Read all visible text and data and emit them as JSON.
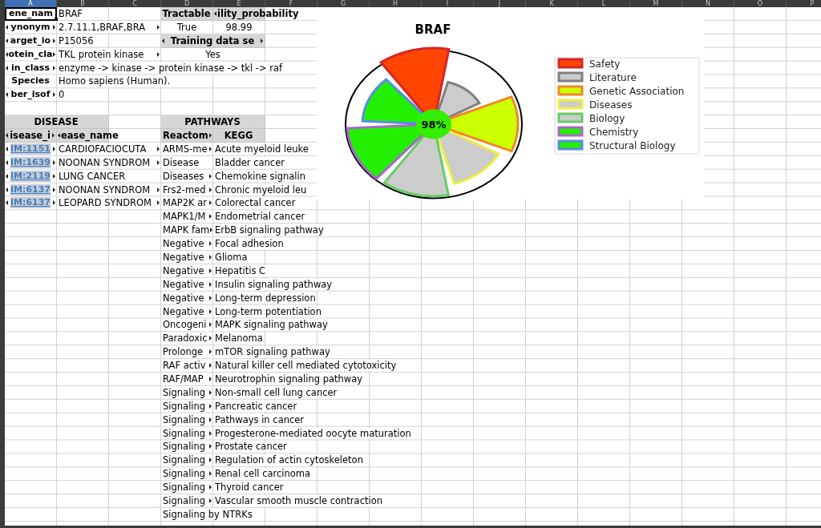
{
  "column_headers": [
    {
      "label": "A",
      "selected": true
    },
    {
      "label": "B",
      "selected": false
    },
    {
      "label": "C",
      "selected": false
    },
    {
      "label": "D",
      "selected": false
    },
    {
      "label": "E",
      "selected": false
    },
    {
      "label": "F",
      "selected": false
    },
    {
      "label": "G",
      "selected": false
    },
    {
      "label": "H",
      "selected": false
    },
    {
      "label": "I",
      "selected": false
    },
    {
      "label": "J",
      "selected": false
    },
    {
      "label": "K",
      "selected": false
    },
    {
      "label": "L",
      "selected": false
    },
    {
      "label": "M",
      "selected": false
    },
    {
      "label": "N",
      "selected": false
    },
    {
      "label": "O",
      "selected": false
    },
    {
      "label": "P",
      "selected": false
    }
  ],
  "sheet": {
    "rows": [
      {
        "cells": {
          "col_a": {
            "text": "ene_nam",
            "kind": "label",
            "centered": true,
            "selected": true
          },
          "col_b": {
            "text": "BRAF",
            "kind": "text",
            "selected": false
          },
          "col_d": {
            "text": "Tractable",
            "kind": "header",
            "centered": true,
            "selected": false
          },
          "col_e": {
            "text": "ility_probability",
            "kind": "header",
            "clipped_left": true,
            "selected": false
          }
        }
      },
      {
        "cells": {
          "col_a": {
            "text": "ynonym",
            "kind": "label",
            "centered": true,
            "clipped_left": true,
            "clipped_right": true,
            "selected": false
          },
          "col_b": {
            "text": "2.7.11.1,BRAF,BRA",
            "kind": "text",
            "clipped_right": true,
            "selected": false
          },
          "col_d": {
            "text": "True",
            "kind": "text",
            "centered": true,
            "selected": false
          },
          "col_e": {
            "text": "98.99",
            "kind": "text",
            "centered": true,
            "selected": false
          }
        }
      },
      {
        "cells": {
          "col_a": {
            "text": "arget_io",
            "kind": "label",
            "centered": true,
            "clipped_left": true,
            "clipped_right": true,
            "selected": false
          },
          "col_b": {
            "text": "P15056",
            "kind": "text",
            "selected": false
          },
          "col_d": {
            "text": "Training data se",
            "kind": "header",
            "centered": true,
            "clipped_left": true,
            "clipped_right": true,
            "merged": true,
            "selected": false
          }
        }
      },
      {
        "cells": {
          "col_a": {
            "text": "otein_cla",
            "kind": "label",
            "centered": true,
            "clipped_left": true,
            "clipped_right": true,
            "selected": false
          },
          "col_b": {
            "text": "TKL protein kinase",
            "kind": "text",
            "clipped_right": true,
            "selected": false
          },
          "col_d": {
            "text": "Yes",
            "kind": "text",
            "centered": true,
            "merged": true,
            "selected": false
          }
        }
      },
      {
        "cells": {
          "col_a": {
            "text": "in_class",
            "kind": "label",
            "centered": true,
            "clipped_left": true,
            "clipped_right": true,
            "selected": false
          },
          "col_b": {
            "text": "enzyme -> kinase -> protein kinase -> tkl -> raf",
            "kind": "text",
            "selected": false
          }
        }
      },
      {
        "cells": {
          "col_a": {
            "text": "Species",
            "kind": "label",
            "centered": true,
            "selected": false
          },
          "col_b": {
            "text": "Homo sapiens (Human).",
            "kind": "text",
            "selected": false
          }
        }
      },
      {
        "cells": {
          "col_a": {
            "text": "ber_isof",
            "kind": "label",
            "centered": true,
            "clipped_left": true,
            "clipped_right": true,
            "selected": false
          },
          "col_b": {
            "text": "0",
            "kind": "text",
            "selected": false
          }
        }
      },
      {},
      {
        "cells": {
          "col_a": {
            "text": "DISEASE",
            "kind": "header",
            "centered": true,
            "merged": true,
            "selected": false
          },
          "col_d": {
            "text": "PATHWAYS",
            "kind": "header",
            "centered": true,
            "merged": true,
            "selected": false
          }
        }
      },
      {
        "cells": {
          "col_a": {
            "text": "isease_i",
            "kind": "header",
            "centered": true,
            "clipped_left": true,
            "clipped_right": true,
            "selected": false
          },
          "col_b": {
            "text": "ease_name",
            "kind": "header",
            "clipped_left": true,
            "selected": false
          },
          "col_d": {
            "text": "Reactom",
            "kind": "header",
            "clipped_right": true,
            "selected": false
          },
          "col_e": {
            "text": "KEGG",
            "kind": "header",
            "centered": true,
            "selected": false
          }
        }
      },
      {
        "cells": {
          "col_a": {
            "text": "IM:1151",
            "kind": "link",
            "centered": true,
            "clipped_left": true,
            "clipped_right": true,
            "selected": false
          },
          "col_b": {
            "text": "CARDIOFACIOCUTA",
            "kind": "text",
            "clipped_right": true,
            "selected": false
          },
          "col_d": {
            "text": "ARMS-me",
            "kind": "text",
            "clipped_right": true,
            "selected": false
          },
          "col_e": {
            "text": "Acute myeloid leuke",
            "kind": "text",
            "selected": false
          }
        }
      },
      {
        "cells": {
          "col_a": {
            "text": "IM:1639",
            "kind": "link",
            "centered": true,
            "clipped_left": true,
            "clipped_right": true,
            "selected": false
          },
          "col_b": {
            "text": "NOONAN SYNDROM",
            "kind": "text",
            "clipped_right": true,
            "selected": false
          },
          "col_d": {
            "text": "Disease",
            "kind": "text",
            "selected": false
          },
          "col_e": {
            "text": "Bladder cancer",
            "kind": "text",
            "selected": false
          }
        }
      },
      {
        "cells": {
          "col_a": {
            "text": "IM:2119",
            "kind": "link",
            "centered": true,
            "clipped_left": true,
            "clipped_right": true,
            "selected": false
          },
          "col_b": {
            "text": "LUNG CANCER",
            "kind": "text",
            "selected": false
          },
          "col_d": {
            "text": "Diseases",
            "kind": "text",
            "clipped_right": true,
            "selected": false
          },
          "col_e": {
            "text": "Chemokine signalin",
            "kind": "text",
            "selected": false
          }
        }
      },
      {
        "cells": {
          "col_a": {
            "text": "IM:6137",
            "kind": "link",
            "centered": true,
            "clipped_left": true,
            "clipped_right": true,
            "selected": false
          },
          "col_b": {
            "text": "NOONAN SYNDROM",
            "kind": "text",
            "clipped_right": true,
            "selected": false
          },
          "col_d": {
            "text": "Frs2-med",
            "kind": "text",
            "clipped_right": true,
            "selected": false
          },
          "col_e": {
            "text": "Chronic myeloid leu",
            "kind": "text",
            "selected": false
          }
        }
      },
      {
        "cells": {
          "col_a": {
            "text": "IM:6137",
            "kind": "link",
            "centered": true,
            "clipped_left": true,
            "clipped_right": true,
            "selected": false
          },
          "col_b": {
            "text": "LEOPARD SYNDROM",
            "kind": "text",
            "clipped_right": true,
            "selected": false
          },
          "col_d": {
            "text": "MAP2K ar",
            "kind": "text",
            "clipped_right": true,
            "selected": false
          },
          "col_e": {
            "text": "Colorectal cancer",
            "kind": "text",
            "selected": false
          }
        }
      },
      {
        "cells": {
          "col_d": {
            "text": "MAPK1/M",
            "kind": "text",
            "clipped_right": true,
            "selected": false
          },
          "col_e": {
            "text": "Endometrial cancer",
            "kind": "text",
            "selected": false
          }
        }
      },
      {
        "cells": {
          "col_d": {
            "text": "MAPK fam",
            "kind": "text",
            "clipped_right": true,
            "selected": false
          },
          "col_e": {
            "text": "ErbB signaling pathway",
            "kind": "text",
            "selected": false
          }
        }
      },
      {
        "cells": {
          "col_d": {
            "text": "Negative",
            "kind": "text",
            "clipped_right": true,
            "selected": false
          },
          "col_e": {
            "text": "Focal adhesion",
            "kind": "text",
            "selected": false
          }
        }
      },
      {
        "cells": {
          "col_d": {
            "text": "Negative",
            "kind": "text",
            "clipped_right": true,
            "selected": false
          },
          "col_e": {
            "text": "Glioma",
            "kind": "text",
            "selected": false
          }
        }
      },
      {
        "cells": {
          "col_d": {
            "text": "Negative",
            "kind": "text",
            "clipped_right": true,
            "selected": false
          },
          "col_e": {
            "text": "Hepatitis C",
            "kind": "text",
            "selected": false
          }
        }
      },
      {
        "cells": {
          "col_d": {
            "text": "Negative",
            "kind": "text",
            "clipped_right": true,
            "selected": false
          },
          "col_e": {
            "text": "Insulin signaling pathway",
            "kind": "text",
            "selected": false
          }
        }
      },
      {
        "cells": {
          "col_d": {
            "text": "Negative",
            "kind": "text",
            "clipped_right": true,
            "selected": false
          },
          "col_e": {
            "text": "Long-term depression",
            "kind": "text",
            "selected": false
          }
        }
      },
      {
        "cells": {
          "col_d": {
            "text": "Negative",
            "kind": "text",
            "clipped_right": true,
            "selected": false
          },
          "col_e": {
            "text": "Long-term potentiation",
            "kind": "text",
            "selected": false
          }
        }
      },
      {
        "cells": {
          "col_d": {
            "text": "Oncogeni",
            "kind": "text",
            "clipped_right": true,
            "selected": false
          },
          "col_e": {
            "text": "MAPK signaling pathway",
            "kind": "text",
            "selected": false
          }
        }
      },
      {
        "cells": {
          "col_d": {
            "text": "Paradoxic",
            "kind": "text",
            "clipped_right": true,
            "selected": false
          },
          "col_e": {
            "text": "Melanoma",
            "kind": "text",
            "selected": false
          }
        }
      },
      {
        "cells": {
          "col_d": {
            "text": "Prolonge",
            "kind": "text",
            "clipped_right": true,
            "selected": false
          },
          "col_e": {
            "text": "mTOR signaling pathway",
            "kind": "text",
            "selected": false
          }
        }
      },
      {
        "cells": {
          "col_d": {
            "text": "RAF activ",
            "kind": "text",
            "clipped_right": true,
            "selected": false
          },
          "col_e": {
            "text": "Natural killer cell mediated cytotoxicity",
            "kind": "text",
            "selected": false
          }
        }
      },
      {
        "cells": {
          "col_d": {
            "text": "RAF/MAP",
            "kind": "text",
            "clipped_right": true,
            "selected": false
          },
          "col_e": {
            "text": "Neurotrophin signaling pathway",
            "kind": "text",
            "selected": false
          }
        }
      },
      {
        "cells": {
          "col_d": {
            "text": "Signaling",
            "kind": "text",
            "clipped_right": true,
            "selected": false
          },
          "col_e": {
            "text": "Non-small cell lung cancer",
            "kind": "text",
            "selected": false
          }
        }
      },
      {
        "cells": {
          "col_d": {
            "text": "Signaling",
            "kind": "text",
            "clipped_right": true,
            "selected": false
          },
          "col_e": {
            "text": "Pancreatic cancer",
            "kind": "text",
            "selected": false
          }
        }
      },
      {
        "cells": {
          "col_d": {
            "text": "Signaling",
            "kind": "text",
            "clipped_right": true,
            "selected": false
          },
          "col_e": {
            "text": "Pathways in cancer",
            "kind": "text",
            "selected": false
          }
        }
      },
      {
        "cells": {
          "col_d": {
            "text": "Signaling",
            "kind": "text",
            "clipped_right": true,
            "selected": false
          },
          "col_e": {
            "text": "Progesterone-mediated oocyte maturation",
            "kind": "text",
            "selected": false
          }
        }
      },
      {
        "cells": {
          "col_d": {
            "text": "Signaling",
            "kind": "text",
            "clipped_right": true,
            "selected": false
          },
          "col_e": {
            "text": "Prostate cancer",
            "kind": "text",
            "selected": false
          }
        }
      },
      {
        "cells": {
          "col_d": {
            "text": "Signaling",
            "kind": "text",
            "clipped_right": true,
            "selected": false
          },
          "col_e": {
            "text": "Regulation of actin cytoskeleton",
            "kind": "text",
            "selected": false
          }
        }
      },
      {
        "cells": {
          "col_d": {
            "text": "Signaling",
            "kind": "text",
            "clipped_right": true,
            "selected": false
          },
          "col_e": {
            "text": "Renal cell carcinoma",
            "kind": "text",
            "selected": false
          }
        }
      },
      {
        "cells": {
          "col_d": {
            "text": "Signaling",
            "kind": "text",
            "clipped_right": true,
            "selected": false
          },
          "col_e": {
            "text": "Thyroid cancer",
            "kind": "text",
            "selected": false
          }
        }
      },
      {
        "cells": {
          "col_d": {
            "text": "Signaling",
            "kind": "text",
            "clipped_right": true,
            "selected": false
          },
          "col_e": {
            "text": "Vascular smooth muscle contraction",
            "kind": "text",
            "selected": false
          }
        }
      },
      {
        "cells": {
          "col_d": {
            "text": "Signaling by NTRKs",
            "kind": "text",
            "selected": false
          }
        }
      }
    ]
  },
  "chart": {
    "title": "BRAF",
    "center_label": "98%",
    "legend": [
      {
        "label": "Safety",
        "color": "#d62728",
        "fill": {
          "color": "#ff4500"
        }
      },
      {
        "label": "Literature",
        "color": "#808080",
        "fill": {
          "color": "#cccccc"
        }
      },
      {
        "label": "Genetic Association",
        "color": "#f0882a",
        "fill": {
          "color": "#ccff00"
        }
      },
      {
        "label": "Diseases",
        "color": "#eeee44",
        "fill": {
          "color": "#cccccc"
        }
      },
      {
        "label": "Biology",
        "color": "#66cc66",
        "fill": {
          "color": "#cccccc"
        }
      },
      {
        "label": "Chemistry",
        "color": "#aa66cc",
        "fill": {
          "color": "#22f000"
        }
      },
      {
        "label": "Structural Biology",
        "color": "#5b8ae6",
        "fill": {
          "color": "#22f000"
        }
      }
    ]
  }
}
